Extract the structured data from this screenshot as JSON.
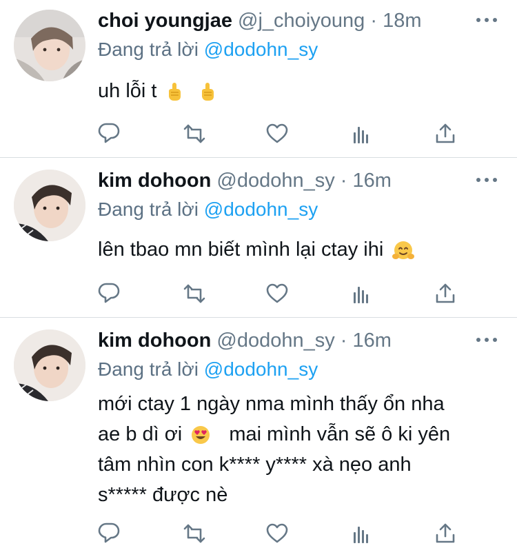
{
  "tweets": [
    {
      "name": "choi youngjae",
      "handle": "@j_choiyoung",
      "separator": "·",
      "time": "18m",
      "reply_prefix": "Đang trả lời",
      "reply_handle": "@dodohn_sy",
      "body_lines": [
        "uh lỗi t"
      ],
      "emojis": [
        "middle-finger-emoji",
        "middle-finger-emoji"
      ]
    },
    {
      "name": "kim dohoon",
      "handle": "@dodohn_sy",
      "separator": "·",
      "time": "16m",
      "reply_prefix": "Đang trả lời",
      "reply_handle": "@dodohn_sy",
      "body_lines": [
        "lên tbao mn biết mình lại ctay ihi"
      ],
      "emojis": [
        "hugging-face-emoji"
      ]
    },
    {
      "name": "kim dohoon",
      "handle": "@dodohn_sy",
      "separator": "·",
      "time": "16m",
      "reply_prefix": "Đang trả lời",
      "reply_handle": "@dodohn_sy",
      "body_lines": [
        "mới ctay 1 ngày nma mình thấy ổn nha",
        "ae b dì ơi",
        "mai mình vẫn sẽ ô ki yên",
        "tâm nhìn con k**** y**** xà nẹo anh",
        "s***** được nè"
      ],
      "emojis": [
        "heart-eyes-emoji"
      ]
    }
  ],
  "action_icons": [
    "reply-icon",
    "retweet-icon",
    "like-icon",
    "analytics-icon",
    "share-icon"
  ],
  "colors": {
    "link": "#1da1f2",
    "secondary_text": "#657786",
    "divider": "#d8dde1",
    "icon": "#657786"
  }
}
